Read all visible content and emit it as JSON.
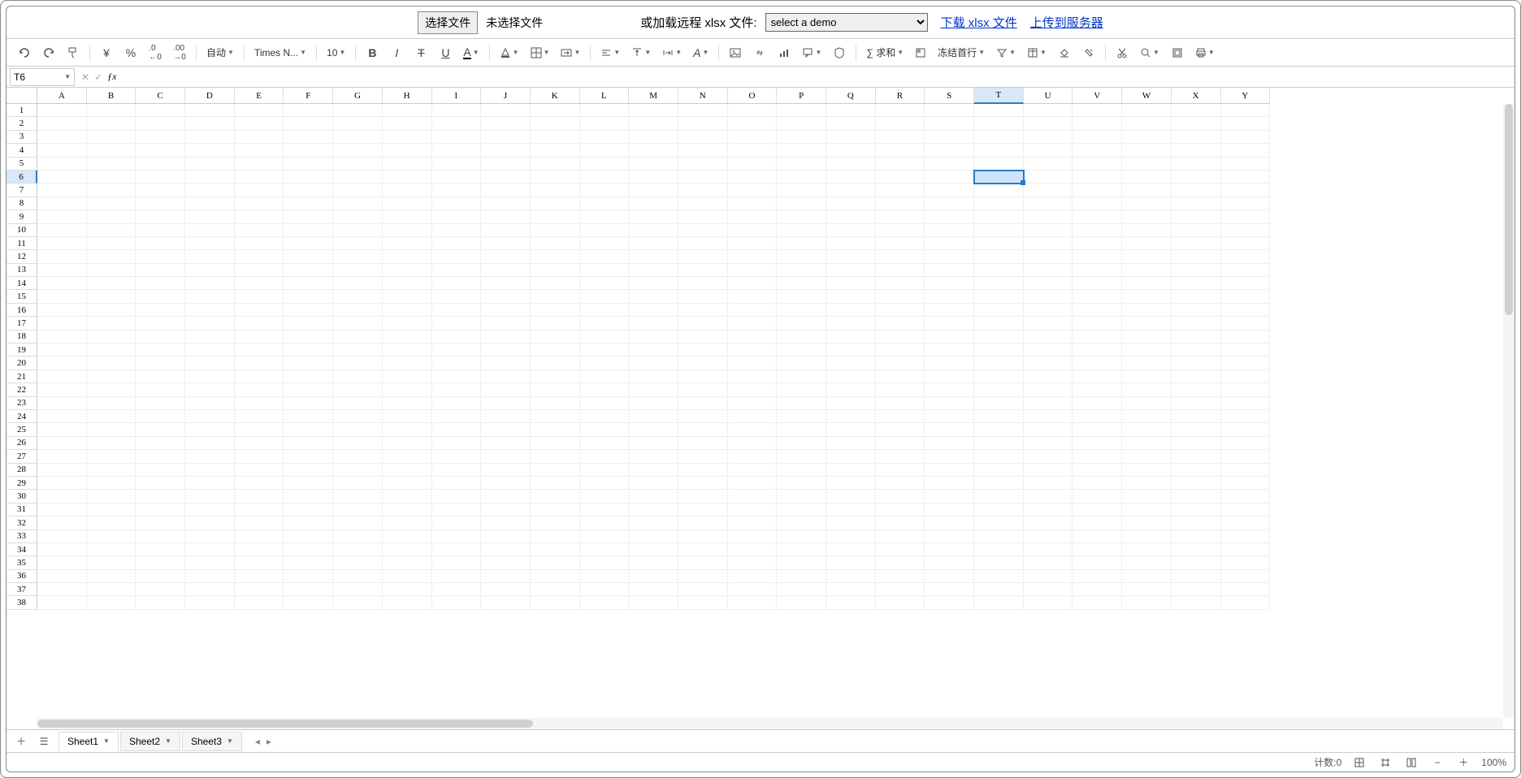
{
  "header": {
    "choose_file": "选择文件",
    "no_file": "未选择文件",
    "remote_label": "或加载远程 xlsx 文件:",
    "demo_placeholder": "select a demo",
    "download_link": "下载 xlsx 文件",
    "upload_link": "上传到服务器"
  },
  "toolbar": {
    "format_mode": "自动",
    "font_name": "Times N...",
    "font_size": "10",
    "sum_label": "∑ 求和",
    "freeze_label": "冻结首行"
  },
  "formula_bar": {
    "cell_ref": "T6",
    "formula": ""
  },
  "grid": {
    "columns": [
      "A",
      "B",
      "C",
      "D",
      "E",
      "F",
      "G",
      "H",
      "I",
      "J",
      "K",
      "L",
      "M",
      "N",
      "O",
      "P",
      "Q",
      "R",
      "S",
      "T",
      "U",
      "V",
      "W",
      "X",
      "Y"
    ],
    "row_count": 38,
    "selected_col": "T",
    "selected_row": 6
  },
  "tabs": {
    "sheets": [
      "Sheet1",
      "Sheet2",
      "Sheet3"
    ],
    "active": 0
  },
  "status": {
    "count_label": "计数:0",
    "zoom": "100%"
  }
}
